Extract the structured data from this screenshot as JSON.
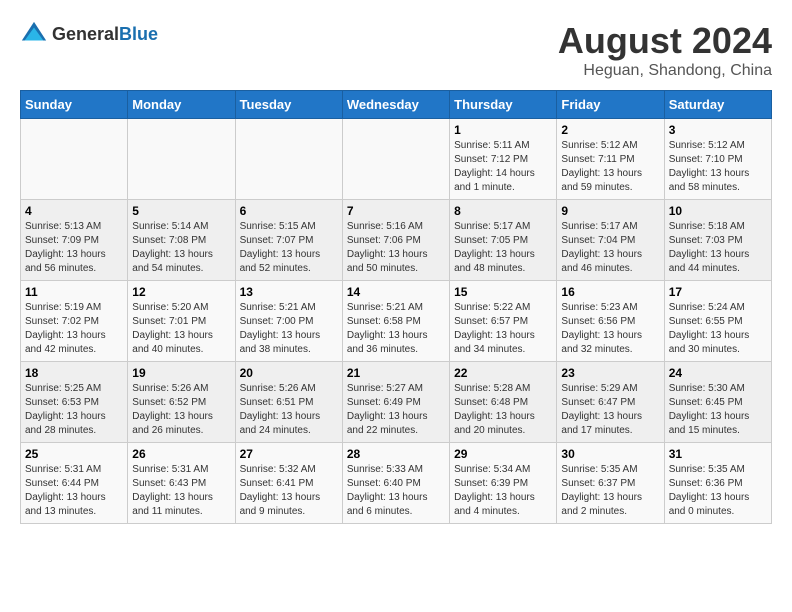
{
  "header": {
    "logo_general": "General",
    "logo_blue": "Blue",
    "month_year": "August 2024",
    "location": "Heguan, Shandong, China"
  },
  "days_of_week": [
    "Sunday",
    "Monday",
    "Tuesday",
    "Wednesday",
    "Thursday",
    "Friday",
    "Saturday"
  ],
  "weeks": [
    [
      {
        "day": "",
        "info": ""
      },
      {
        "day": "",
        "info": ""
      },
      {
        "day": "",
        "info": ""
      },
      {
        "day": "",
        "info": ""
      },
      {
        "day": "1",
        "info": "Sunrise: 5:11 AM\nSunset: 7:12 PM\nDaylight: 14 hours\nand 1 minute."
      },
      {
        "day": "2",
        "info": "Sunrise: 5:12 AM\nSunset: 7:11 PM\nDaylight: 13 hours\nand 59 minutes."
      },
      {
        "day": "3",
        "info": "Sunrise: 5:12 AM\nSunset: 7:10 PM\nDaylight: 13 hours\nand 58 minutes."
      }
    ],
    [
      {
        "day": "4",
        "info": "Sunrise: 5:13 AM\nSunset: 7:09 PM\nDaylight: 13 hours\nand 56 minutes."
      },
      {
        "day": "5",
        "info": "Sunrise: 5:14 AM\nSunset: 7:08 PM\nDaylight: 13 hours\nand 54 minutes."
      },
      {
        "day": "6",
        "info": "Sunrise: 5:15 AM\nSunset: 7:07 PM\nDaylight: 13 hours\nand 52 minutes."
      },
      {
        "day": "7",
        "info": "Sunrise: 5:16 AM\nSunset: 7:06 PM\nDaylight: 13 hours\nand 50 minutes."
      },
      {
        "day": "8",
        "info": "Sunrise: 5:17 AM\nSunset: 7:05 PM\nDaylight: 13 hours\nand 48 minutes."
      },
      {
        "day": "9",
        "info": "Sunrise: 5:17 AM\nSunset: 7:04 PM\nDaylight: 13 hours\nand 46 minutes."
      },
      {
        "day": "10",
        "info": "Sunrise: 5:18 AM\nSunset: 7:03 PM\nDaylight: 13 hours\nand 44 minutes."
      }
    ],
    [
      {
        "day": "11",
        "info": "Sunrise: 5:19 AM\nSunset: 7:02 PM\nDaylight: 13 hours\nand 42 minutes."
      },
      {
        "day": "12",
        "info": "Sunrise: 5:20 AM\nSunset: 7:01 PM\nDaylight: 13 hours\nand 40 minutes."
      },
      {
        "day": "13",
        "info": "Sunrise: 5:21 AM\nSunset: 7:00 PM\nDaylight: 13 hours\nand 38 minutes."
      },
      {
        "day": "14",
        "info": "Sunrise: 5:21 AM\nSunset: 6:58 PM\nDaylight: 13 hours\nand 36 minutes."
      },
      {
        "day": "15",
        "info": "Sunrise: 5:22 AM\nSunset: 6:57 PM\nDaylight: 13 hours\nand 34 minutes."
      },
      {
        "day": "16",
        "info": "Sunrise: 5:23 AM\nSunset: 6:56 PM\nDaylight: 13 hours\nand 32 minutes."
      },
      {
        "day": "17",
        "info": "Sunrise: 5:24 AM\nSunset: 6:55 PM\nDaylight: 13 hours\nand 30 minutes."
      }
    ],
    [
      {
        "day": "18",
        "info": "Sunrise: 5:25 AM\nSunset: 6:53 PM\nDaylight: 13 hours\nand 28 minutes."
      },
      {
        "day": "19",
        "info": "Sunrise: 5:26 AM\nSunset: 6:52 PM\nDaylight: 13 hours\nand 26 minutes."
      },
      {
        "day": "20",
        "info": "Sunrise: 5:26 AM\nSunset: 6:51 PM\nDaylight: 13 hours\nand 24 minutes."
      },
      {
        "day": "21",
        "info": "Sunrise: 5:27 AM\nSunset: 6:49 PM\nDaylight: 13 hours\nand 22 minutes."
      },
      {
        "day": "22",
        "info": "Sunrise: 5:28 AM\nSunset: 6:48 PM\nDaylight: 13 hours\nand 20 minutes."
      },
      {
        "day": "23",
        "info": "Sunrise: 5:29 AM\nSunset: 6:47 PM\nDaylight: 13 hours\nand 17 minutes."
      },
      {
        "day": "24",
        "info": "Sunrise: 5:30 AM\nSunset: 6:45 PM\nDaylight: 13 hours\nand 15 minutes."
      }
    ],
    [
      {
        "day": "25",
        "info": "Sunrise: 5:31 AM\nSunset: 6:44 PM\nDaylight: 13 hours\nand 13 minutes."
      },
      {
        "day": "26",
        "info": "Sunrise: 5:31 AM\nSunset: 6:43 PM\nDaylight: 13 hours\nand 11 minutes."
      },
      {
        "day": "27",
        "info": "Sunrise: 5:32 AM\nSunset: 6:41 PM\nDaylight: 13 hours\nand 9 minutes."
      },
      {
        "day": "28",
        "info": "Sunrise: 5:33 AM\nSunset: 6:40 PM\nDaylight: 13 hours\nand 6 minutes."
      },
      {
        "day": "29",
        "info": "Sunrise: 5:34 AM\nSunset: 6:39 PM\nDaylight: 13 hours\nand 4 minutes."
      },
      {
        "day": "30",
        "info": "Sunrise: 5:35 AM\nSunset: 6:37 PM\nDaylight: 13 hours\nand 2 minutes."
      },
      {
        "day": "31",
        "info": "Sunrise: 5:35 AM\nSunset: 6:36 PM\nDaylight: 13 hours\nand 0 minutes."
      }
    ]
  ]
}
